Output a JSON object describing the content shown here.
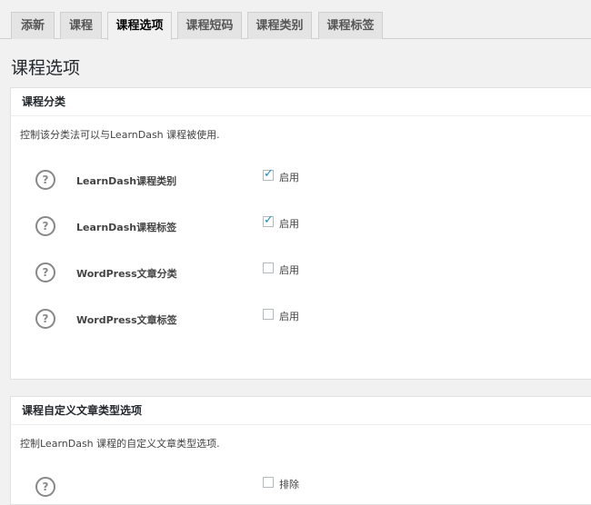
{
  "tabs": [
    {
      "label": "添新"
    },
    {
      "label": "课程"
    },
    {
      "label": "课程选项"
    },
    {
      "label": "课程短码"
    },
    {
      "label": "课程类别"
    },
    {
      "label": "课程标签"
    }
  ],
  "page_title": "课程选项",
  "section1": {
    "title": "课程分类",
    "description": "控制该分类法可以与LearnDash 课程被使用.",
    "rows": [
      {
        "label": "LearnDash课程类别",
        "checkbox_label": "启用",
        "checked": true
      },
      {
        "label": "LearnDash课程标签",
        "checkbox_label": "启用",
        "checked": true
      },
      {
        "label": "WordPress文章分类",
        "checkbox_label": "启用",
        "checked": false
      },
      {
        "label": "WordPress文章标签",
        "checkbox_label": "启用",
        "checked": false
      }
    ]
  },
  "section2": {
    "title": "课程自定义文章类型选项",
    "description": "控制LearnDash 课程的自定义文章类型选项.",
    "rows": [
      {
        "label": "",
        "checkbox_label": "排除",
        "checked": false
      }
    ]
  },
  "icons": {
    "help": "question-circle-icon",
    "check": "checkmark-icon"
  },
  "colors": {
    "accent": "#1e8cbe",
    "background": "#f1f1f1"
  }
}
